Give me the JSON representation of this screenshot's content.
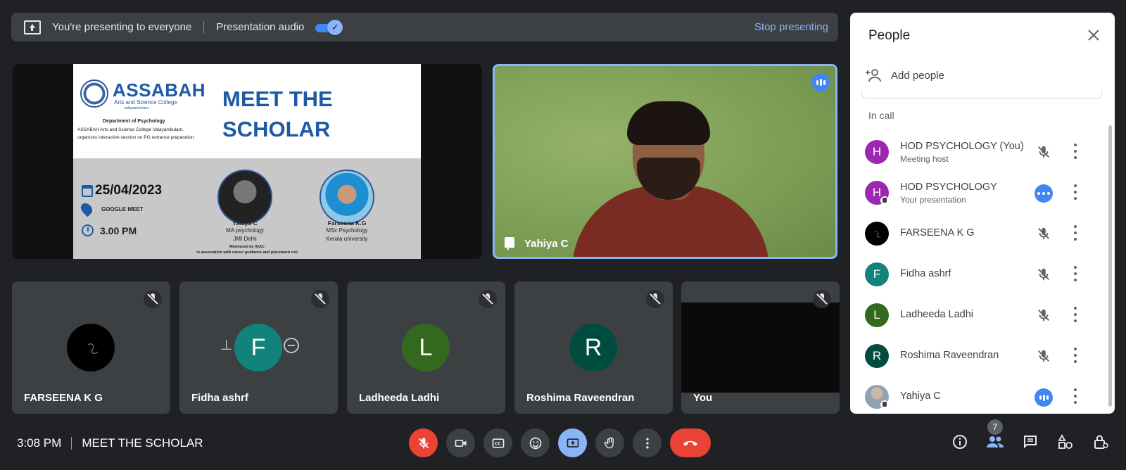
{
  "banner": {
    "presenting_text": "You're presenting to everyone",
    "audio_label": "Presentation audio",
    "stop_label": "Stop presenting"
  },
  "slide": {
    "college_name": "ASSABAH",
    "college_sub": "Arts and Science College",
    "college_place": "valayamkulam",
    "department": "Department of Psychology",
    "description": "ASSABAH Arts and Science College Valayamkulam, organizes interactive session on PG entrance preparation",
    "title_line1": "MEET THE",
    "title_line2": "SCHOLAR",
    "date": "25/04/2023",
    "platform": "GOOGLE MEET",
    "time": "3.00 PM",
    "speaker1": {
      "name": "Yahiya C",
      "line1": "MA psychology",
      "line2": "JMI Delhi"
    },
    "speaker2": {
      "name": "Farseena K.G",
      "line1": "MSc Psychology",
      "line2": "Kerala university"
    },
    "monitor_line1": "Monitored by IQAC",
    "monitor_line2": "In association with career guidance and placement cell"
  },
  "main_tile": {
    "name": "Yahiya C"
  },
  "tiles": [
    {
      "name": "FARSEENA K G",
      "initial": "",
      "color": "#000000"
    },
    {
      "name": "Fidha ashrf",
      "initial": "F",
      "color": "#12837a"
    },
    {
      "name": "Ladheeda Ladhi",
      "initial": "L",
      "color": "#33691e"
    },
    {
      "name": "Roshima Raveendran",
      "initial": "R",
      "color": "#004d40"
    },
    {
      "name": "You",
      "initial": "",
      "color": "#0a0a0a"
    }
  ],
  "bottom_bar": {
    "time": "3:08 PM",
    "meeting_name": "MEET THE SCHOLAR",
    "people_count": "7"
  },
  "panel": {
    "title": "People",
    "add_people": "Add people",
    "in_call": "In call",
    "participants": [
      {
        "initial": "H",
        "color": "#9c27b0",
        "name": "HOD PSYCHOLOGY (You)",
        "sub": "Meeting host",
        "status": "muted"
      },
      {
        "initial": "H",
        "color": "#9c27b0",
        "name": "HOD PSYCHOLOGY",
        "sub": "Your presentation",
        "status": "talking"
      },
      {
        "initial": "",
        "color": "#000000",
        "name": "FARSEENA K G",
        "sub": "",
        "status": "muted"
      },
      {
        "initial": "F",
        "color": "#12837a",
        "name": "Fidha ashrf",
        "sub": "",
        "status": "muted"
      },
      {
        "initial": "L",
        "color": "#33691e",
        "name": "Ladheeda Ladhi",
        "sub": "",
        "status": "muted"
      },
      {
        "initial": "R",
        "color": "#004d40",
        "name": "Roshima Raveendran",
        "sub": "",
        "status": "muted"
      },
      {
        "initial": "",
        "color": "#7a8a9a",
        "name": "Yahiya C",
        "sub": "",
        "status": "talking"
      }
    ]
  }
}
